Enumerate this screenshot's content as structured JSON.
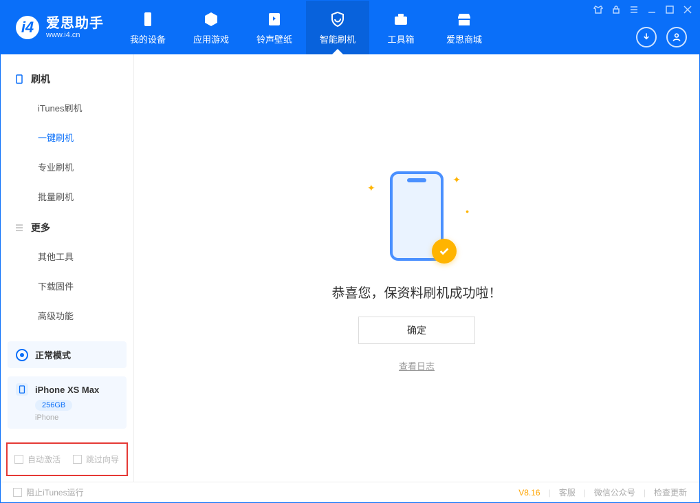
{
  "brand": {
    "title": "爱思助手",
    "subtitle": "www.i4.cn"
  },
  "nav": {
    "items": [
      {
        "label": "我的设备"
      },
      {
        "label": "应用游戏"
      },
      {
        "label": "铃声壁纸"
      },
      {
        "label": "智能刷机"
      },
      {
        "label": "工具箱"
      },
      {
        "label": "爱思商城"
      }
    ]
  },
  "sidebar": {
    "group1": "刷机",
    "items1": [
      "iTunes刷机",
      "一键刷机",
      "专业刷机",
      "批量刷机"
    ],
    "group2": "更多",
    "items2": [
      "其他工具",
      "下载固件",
      "高级功能"
    ]
  },
  "mode": {
    "label": "正常模式"
  },
  "device": {
    "name": "iPhone XS Max",
    "storage": "256GB",
    "type": "iPhone"
  },
  "options": {
    "auto_activate": "自动激活",
    "skip_guide": "跳过向导"
  },
  "main": {
    "success": "恭喜您，保资料刷机成功啦！",
    "ok": "确定",
    "view_log": "查看日志"
  },
  "footer": {
    "block_itunes": "阻止iTunes运行",
    "version": "V8.16",
    "support": "客服",
    "wechat": "微信公众号",
    "update": "检查更新"
  }
}
